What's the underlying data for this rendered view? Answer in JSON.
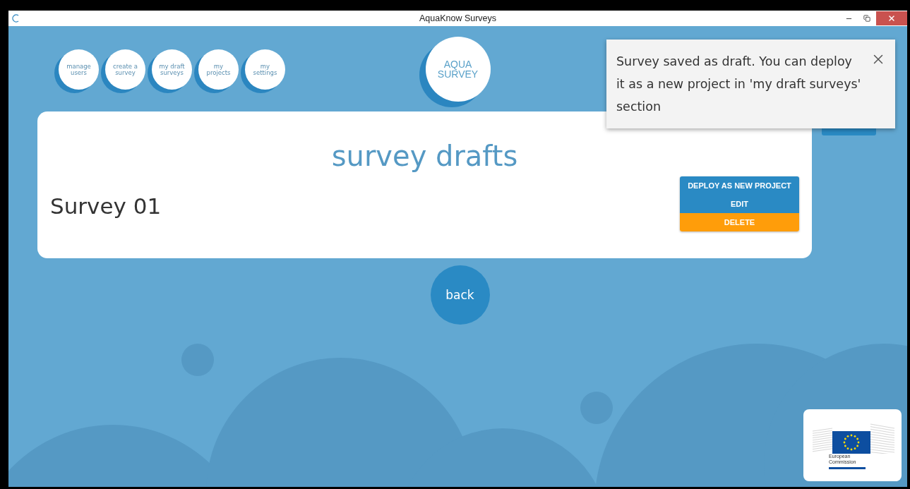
{
  "window": {
    "title": "AquaKnow Surveys"
  },
  "nav": [
    {
      "label": "manage users"
    },
    {
      "label": "create a survey"
    },
    {
      "label": "my draft surveys"
    },
    {
      "label": "my projects"
    },
    {
      "label": "my settings"
    }
  ],
  "logo": {
    "text": "AQUA SURVEY"
  },
  "panel": {
    "title": "survey drafts",
    "survey": "Survey 01",
    "actions": [
      {
        "label": "DEPLOY AS NEW PROJECT",
        "kind": "primary"
      },
      {
        "label": "EDIT",
        "kind": "primary"
      },
      {
        "label": "DELETE",
        "kind": "danger"
      }
    ]
  },
  "back": {
    "label": "back"
  },
  "toast": {
    "message": "Survey saved as draft. You can deploy it as a new project in 'my draft surveys' section"
  },
  "footer_logo": {
    "line_1": "European",
    "line_2": "Commission"
  }
}
